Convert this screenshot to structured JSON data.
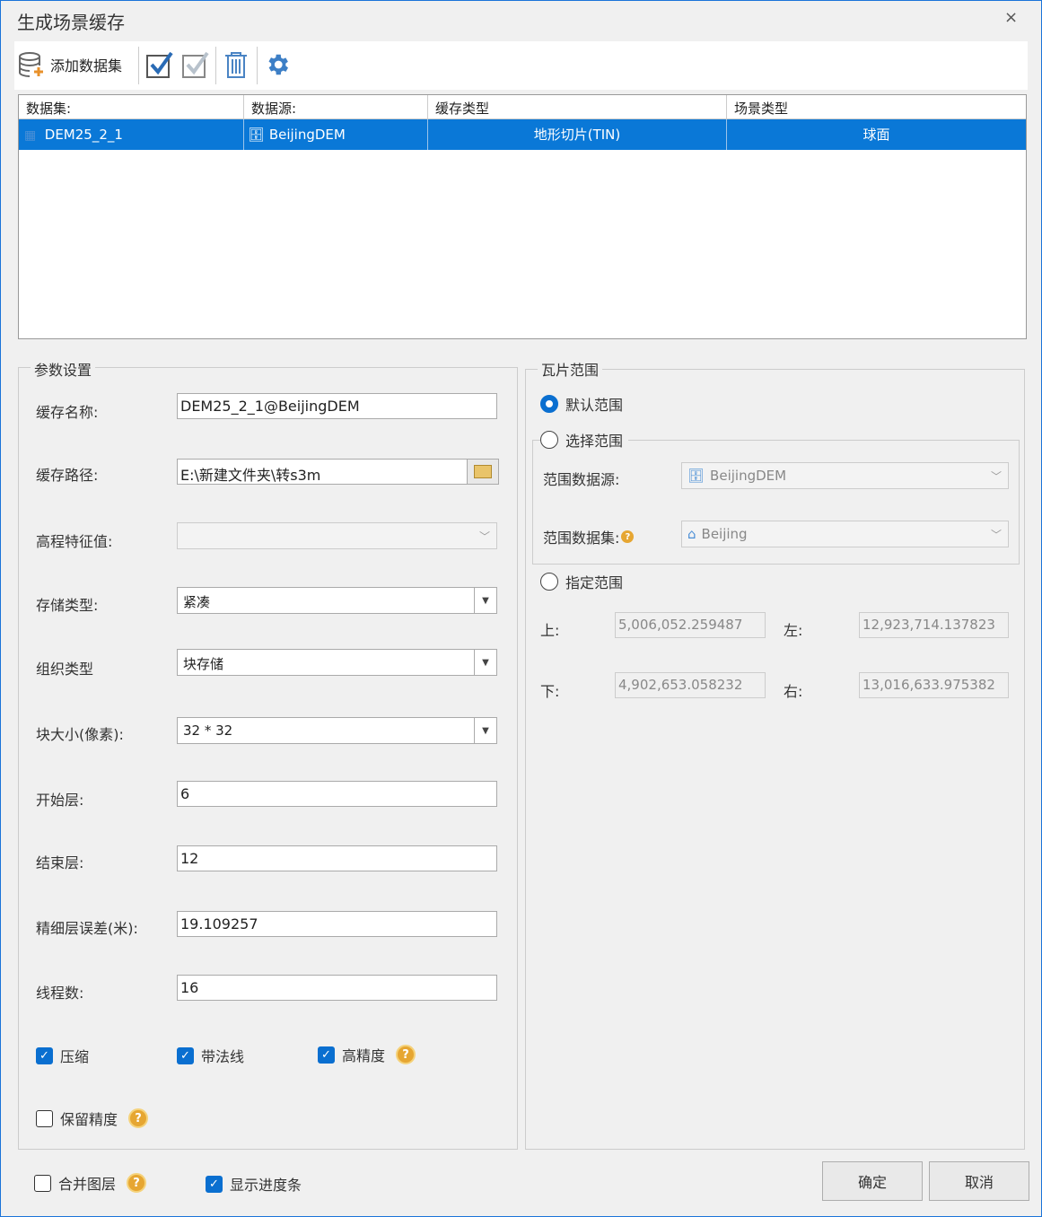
{
  "window": {
    "title": "生成场景缓存",
    "close": "×"
  },
  "toolbar": {
    "add_dataset": "添加数据集"
  },
  "grid": {
    "headers": [
      "数据集:",
      "数据源:",
      "缓存类型",
      "场景类型"
    ],
    "rows": [
      {
        "dataset": "DEM25_2_1",
        "datasource": "BeijingDEM",
        "cache_type": "地形切片(TIN)",
        "scene_type": "球面"
      }
    ]
  },
  "params": {
    "title": "参数设置",
    "cache_name_label": "缓存名称:",
    "cache_name": "DEM25_2_1@BeijingDEM",
    "cache_path_label": "缓存路径:",
    "cache_path": "E:\\新建文件夹\\转s3m",
    "elevation_label": "高程特征值:",
    "elevation": "",
    "storage_label": "存储类型:",
    "storage": "紧凑",
    "org_label": "组织类型",
    "org": "块存储",
    "block_label": "块大小(像素):",
    "block": "32 * 32",
    "start_label": "开始层:",
    "start": "6",
    "end_label": "结束层:",
    "end": "12",
    "error_label": "精细层误差(米):",
    "error": "19.109257",
    "threads_label": "线程数:",
    "threads": "16",
    "compress": "压缩",
    "normals": "带法线",
    "high_precision": "高精度",
    "keep_precision": "保留精度"
  },
  "range": {
    "title": "瓦片范围",
    "default": "默认范围",
    "select": "选择范围",
    "ds_label": "范围数据源:",
    "ds": "BeijingDEM",
    "dataset_label": "范围数据集:",
    "dataset": "Beijing",
    "specify": "指定范围",
    "top_label": "上:",
    "top": "5,006,052.259487",
    "left_label": "左:",
    "left": "12,923,714.137823",
    "bottom_label": "下:",
    "bottom": "4,902,653.058232",
    "right_label": "右:",
    "right": "13,016,633.975382"
  },
  "footer": {
    "merge": "合并图层",
    "progress": "显示进度条",
    "ok": "确定",
    "cancel": "取消"
  },
  "colors": {
    "accent": "#0a78d7",
    "help": "#e6a632"
  }
}
